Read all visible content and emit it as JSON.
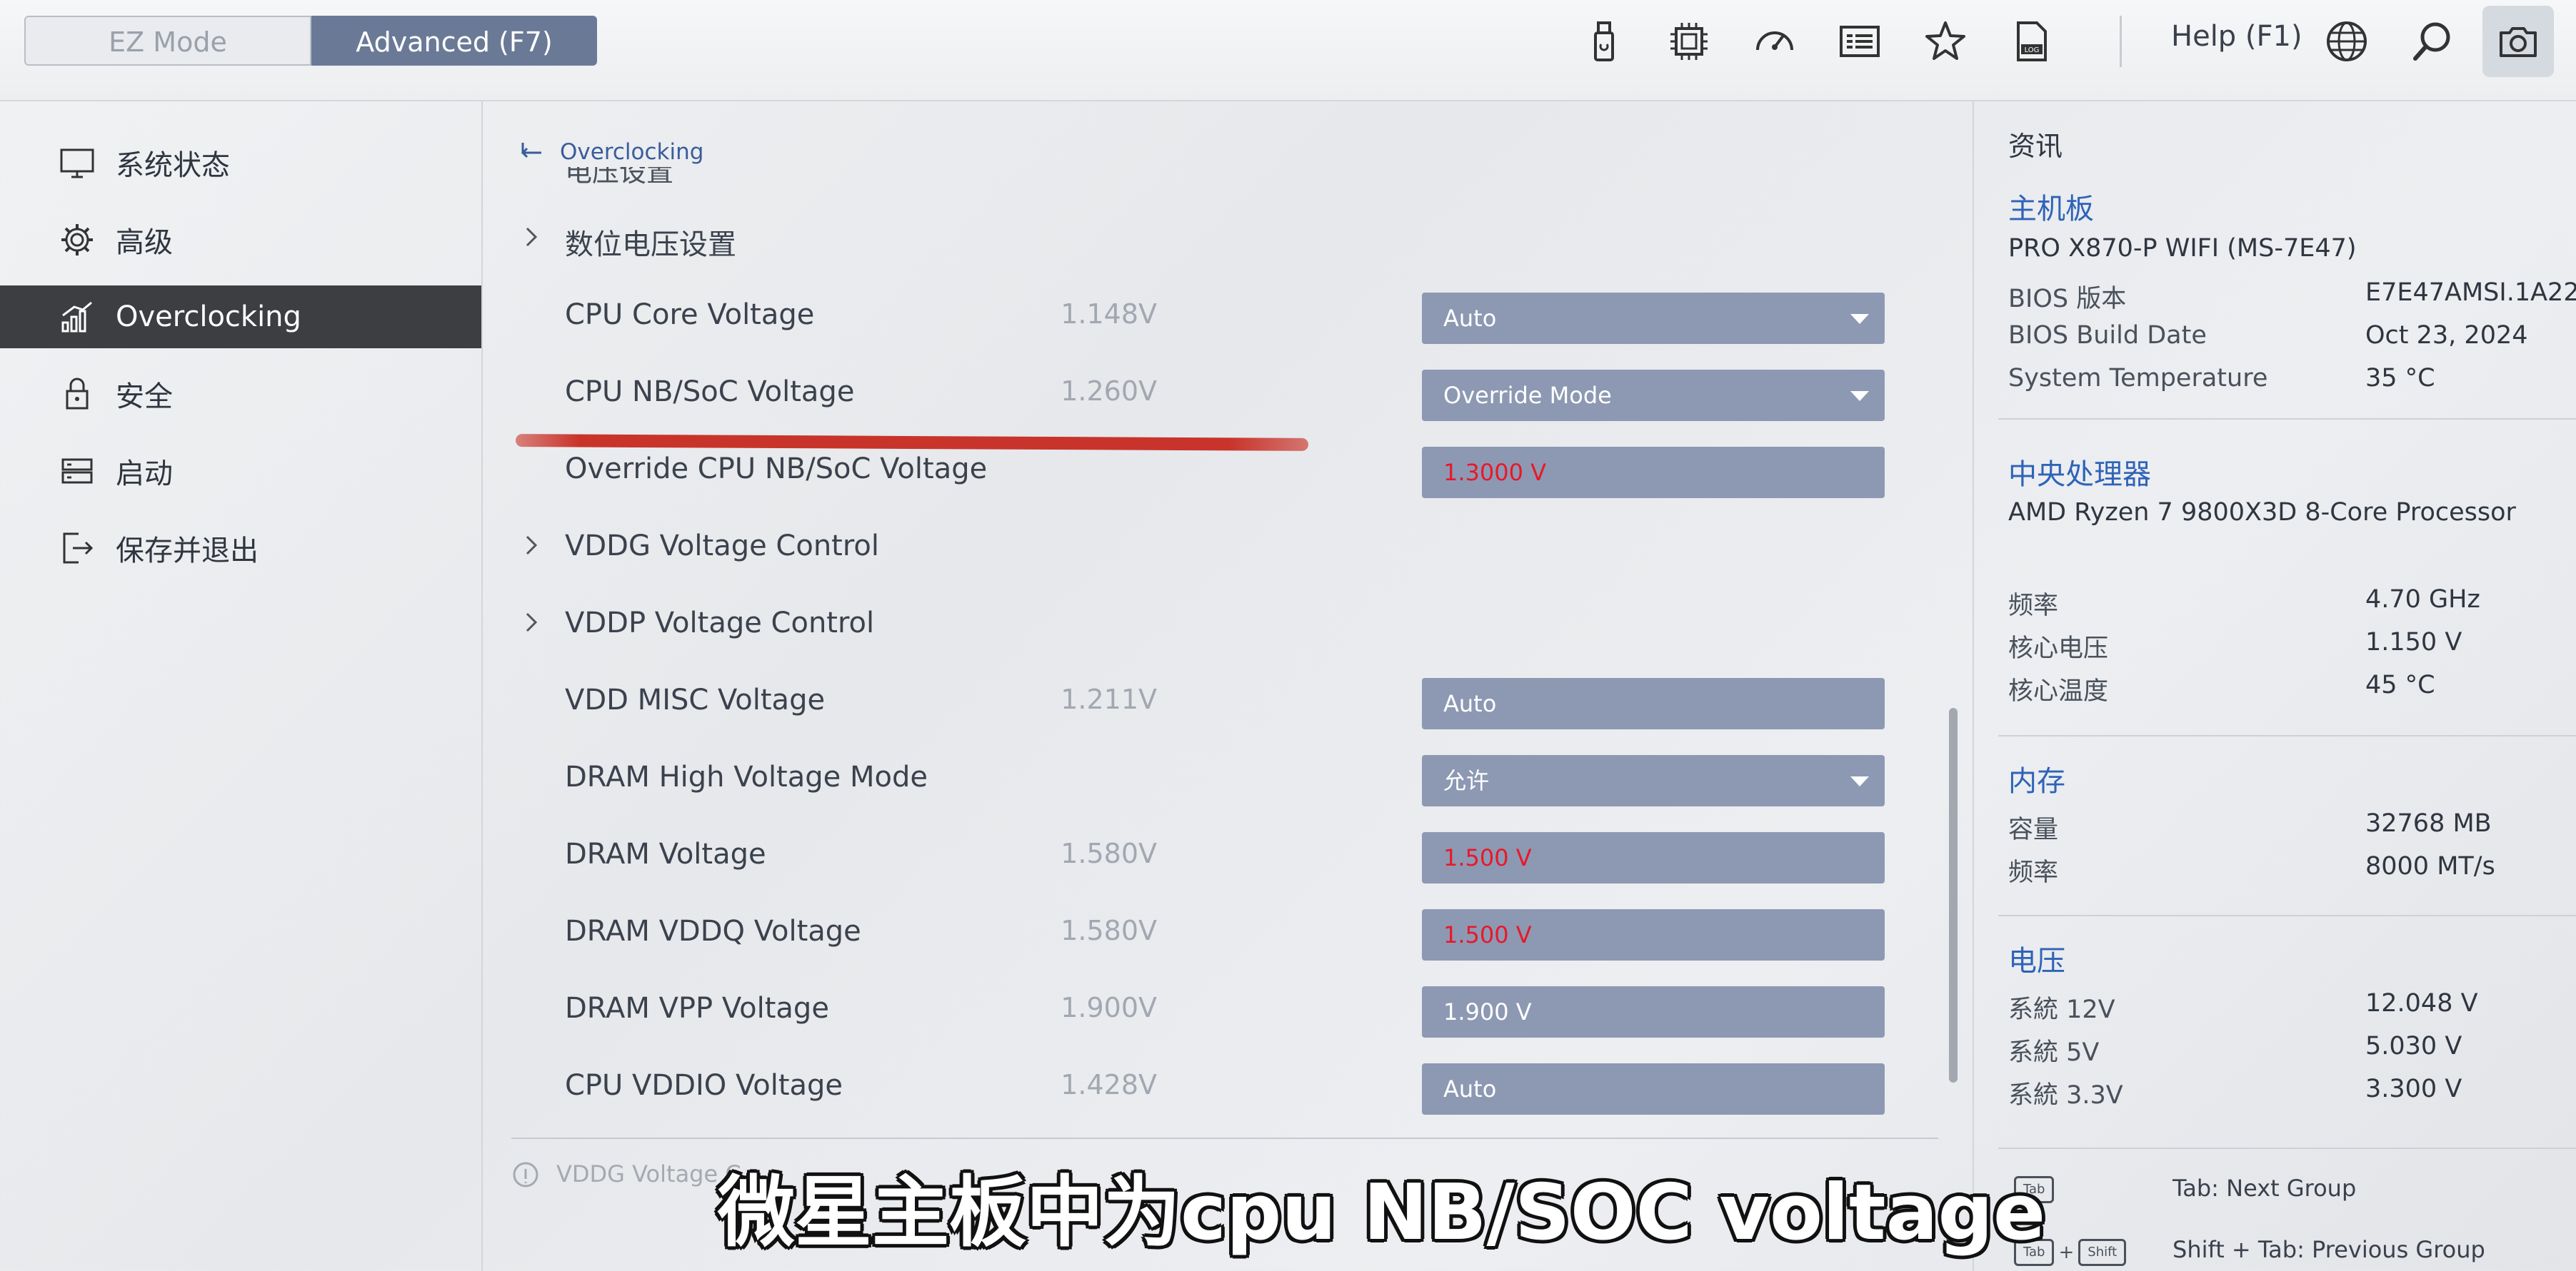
{
  "topbar": {
    "ez_mode": "EZ Mode",
    "advanced_mode": "Advanced (F7)",
    "help": "Help (F1)"
  },
  "sidebar": {
    "items": [
      {
        "label": "系统状态",
        "icon": "monitor-icon"
      },
      {
        "label": "高级",
        "icon": "gear-icon"
      },
      {
        "label": "Overclocking",
        "icon": "chart-bars-icon",
        "active": true
      },
      {
        "label": "安全",
        "icon": "lock-icon"
      },
      {
        "label": "启动",
        "icon": "storage-icon"
      },
      {
        "label": "保存并退出",
        "icon": "exit-icon"
      }
    ]
  },
  "main": {
    "breadcrumb": "Overclocking",
    "cut_heading": "电压设置",
    "rows": [
      {
        "label": "数位电压设置",
        "expandable": true
      },
      {
        "label": "CPU Core Voltage",
        "current": "1.148V",
        "value": "Auto",
        "dropdown": true
      },
      {
        "label": "CPU NB/SoC Voltage",
        "current": "1.260V",
        "value": "Override Mode",
        "dropdown": true
      },
      {
        "label": "Override CPU NB/SoC Voltage",
        "value": "1.3000 V",
        "red": true
      },
      {
        "label": "VDDG Voltage Control",
        "expandable": true
      },
      {
        "label": "VDDP Voltage Control",
        "expandable": true
      },
      {
        "label": "VDD MISC Voltage",
        "current": "1.211V",
        "value": "Auto"
      },
      {
        "label": "DRAM High Voltage Mode",
        "value": "允许",
        "dropdown": true
      },
      {
        "label": "DRAM Voltage",
        "current": "1.580V",
        "value": "1.500 V",
        "red": true
      },
      {
        "label": "DRAM VDDQ Voltage",
        "current": "1.580V",
        "value": "1.500 V",
        "red": true
      },
      {
        "label": "DRAM VPP Voltage",
        "current": "1.900V",
        "value": "1.900 V"
      },
      {
        "label": "CPU VDDIO Voltage",
        "current": "1.428V",
        "value": "Auto"
      }
    ],
    "hint": "VDDG Voltage C"
  },
  "info": {
    "title": "资讯",
    "mb_section": "主机板",
    "mb_name": "PRO X870-P WIFI (MS-7E47)",
    "bios_version_key": "BIOS 版本",
    "bios_version": "E7E47AMSI.1A22",
    "bios_date_key": "BIOS Build Date",
    "bios_date": "Oct 23, 2024",
    "sys_temp_key": "System Temperature",
    "sys_temp": "35 °C",
    "cpu_section": "中央处理器",
    "cpu_name": "AMD Ryzen 7 9800X3D 8-Core Processor",
    "freq_key": "频率",
    "freq": "4.70 GHz",
    "core_v_key": "核心电压",
    "core_v": "1.150 V",
    "core_t_key": "核心温度",
    "core_t": "45 °C",
    "mem_section": "内存",
    "cap_key": "容量",
    "cap": "32768 MB",
    "mem_freq_key": "频率",
    "mem_freq": "8000 MT/s",
    "volt_section": "电压",
    "v12_key": "系統 12V",
    "v12": "12.048 V",
    "v5_key": "系統 5V",
    "v5": "5.030 V",
    "v33_key": "系統 3.3V",
    "v33": "3.300 V",
    "key_tab": "Tab",
    "key_shift": "Shift",
    "key_plus": "+",
    "tab_desc": "Tab: Next Group",
    "shift_tab_desc": "Shift + Tab: Previous Group"
  },
  "subtitle": "微星主板中为cpu NB/SOC voltage",
  "colors": {
    "accent": "#2f63b8",
    "field_bg": "#8d99b3",
    "warn_text": "#e8182a",
    "active_nav": "#3c3e42",
    "annotation_stroke": "#c8342b"
  }
}
